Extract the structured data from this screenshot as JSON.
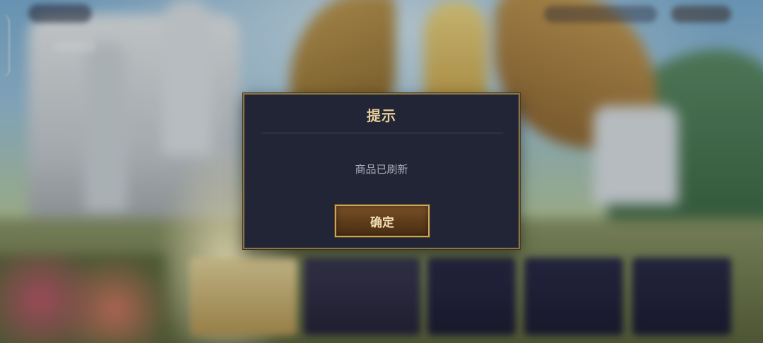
{
  "dialog": {
    "title": "提示",
    "message": "商品已刷新",
    "confirm_label": "确定"
  },
  "colors": {
    "dialog_background": "#222536",
    "dialog_border": "#8a7443",
    "title_text": "#e6cf9a",
    "message_text": "#a8a9b3",
    "button_gold": "#c9a760",
    "button_brown": "#5c3b19"
  }
}
